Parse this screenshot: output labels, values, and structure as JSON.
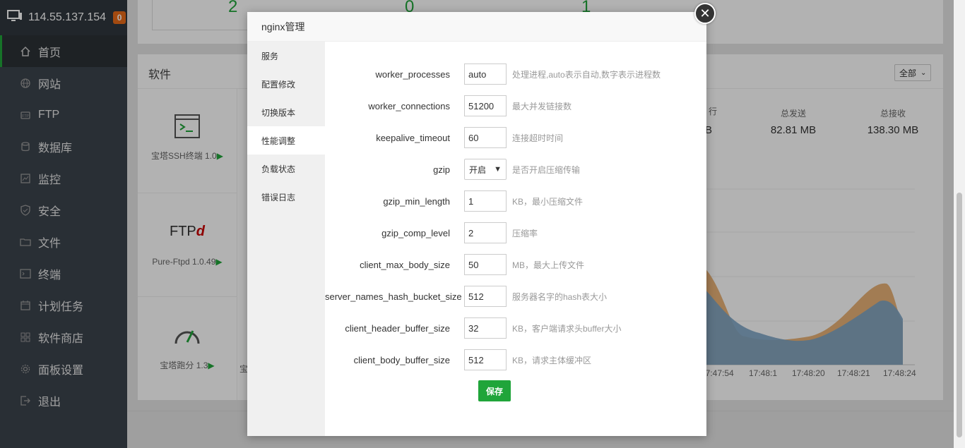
{
  "sidebar": {
    "server_ip": "114.55.137.154",
    "badge_count": "0",
    "items": [
      {
        "label": "首页",
        "icon": "home-icon"
      },
      {
        "label": "网站",
        "icon": "globe-icon"
      },
      {
        "label": "FTP",
        "icon": "ftp-icon"
      },
      {
        "label": "数据库",
        "icon": "database-icon"
      },
      {
        "label": "监控",
        "icon": "monitor-icon"
      },
      {
        "label": "安全",
        "icon": "shield-icon"
      },
      {
        "label": "文件",
        "icon": "folder-icon"
      },
      {
        "label": "终端",
        "icon": "terminal-icon"
      },
      {
        "label": "计划任务",
        "icon": "calendar-icon"
      },
      {
        "label": "软件商店",
        "icon": "grid-icon"
      },
      {
        "label": "面板设置",
        "icon": "gear-icon"
      },
      {
        "label": "退出",
        "icon": "logout-icon"
      }
    ]
  },
  "background": {
    "stats": [
      "2",
      "0",
      "1"
    ],
    "software_title": "软件",
    "filter_value": "全部",
    "software": [
      {
        "name": "宝塔SSH终端 1.0"
      },
      {
        "name": "Pure-Ftpd 1.0.49"
      },
      {
        "name": "宝塔跑分 1.3"
      }
    ],
    "partial_label": "宝",
    "net": {
      "partial_value": "B",
      "partial_char": "行",
      "sent_label": "总发送",
      "sent_value": "82.81 MB",
      "recv_label": "总接收",
      "recv_value": "138.30 MB"
    },
    "chart_xticks": [
      "17:47:54",
      "17:48:1",
      "17:48:20",
      "17:48:21",
      "17:48:24"
    ]
  },
  "modal": {
    "title": "nginx管理",
    "menu": [
      "服务",
      "配置修改",
      "切换版本",
      "性能调整",
      "负载状态",
      "错误日志"
    ],
    "active_menu": "性能调整",
    "fields": [
      {
        "label": "worker_processes",
        "value": "auto",
        "hint": "处理进程,auto表示自动,数字表示进程数"
      },
      {
        "label": "worker_connections",
        "value": "51200",
        "hint": "最大并发链接数"
      },
      {
        "label": "keepalive_timeout",
        "value": "60",
        "hint": "连接超时时间"
      },
      {
        "label": "gzip",
        "value": "开启",
        "hint": "是否开启压缩传输"
      },
      {
        "label": "gzip_min_length",
        "value": "1",
        "hint": "KB，最小压缩文件"
      },
      {
        "label": "gzip_comp_level",
        "value": "2",
        "hint": "压缩率"
      },
      {
        "label": "client_max_body_size",
        "value": "50",
        "hint": "MB，最大上传文件"
      },
      {
        "label": "server_names_hash_bucket_size",
        "value": "512",
        "hint": "服务器名字的hash表大小"
      },
      {
        "label": "client_header_buffer_size",
        "value": "32",
        "hint": "KB，客户端请求头buffer大小"
      },
      {
        "label": "client_body_buffer_size",
        "value": "512",
        "hint": "KB，请求主体缓冲区"
      }
    ],
    "save_label": "保存"
  },
  "colors": {
    "accent": "#20a53a",
    "sidebar_bg": "#3c444d",
    "chart_orange": "#e8b277",
    "chart_blue": "#7ba3c4"
  }
}
